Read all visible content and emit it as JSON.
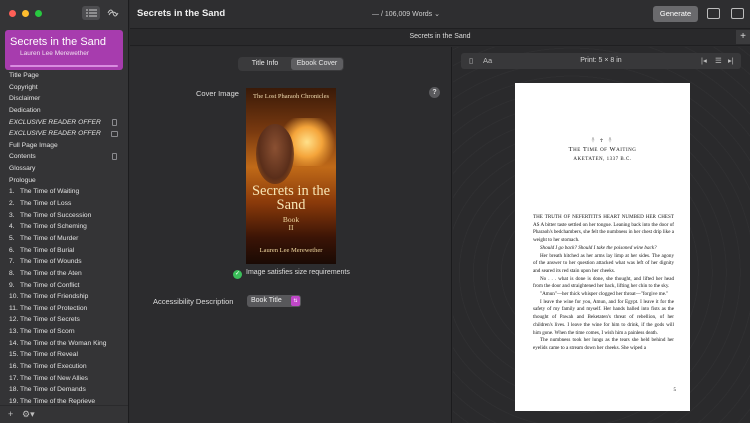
{
  "window": {
    "traffic_colors": [
      "#ff5f57",
      "#febc2e",
      "#28c840"
    ]
  },
  "sidebar": {
    "book_title": "Secrets in the Sand",
    "author": "Lauren Lee Merewether",
    "items": [
      {
        "label": "Title Page"
      },
      {
        "label": "Copyright"
      },
      {
        "label": "Disclaimer"
      },
      {
        "label": "Dedication"
      },
      {
        "label": "EXCLUSIVE READER OFFER",
        "italic": true,
        "icon": "phone-icon"
      },
      {
        "label": "EXCLUSIVE READER OFFER",
        "italic": true,
        "icon": "book-icon"
      },
      {
        "label": "Full Page Image"
      },
      {
        "label": "Contents",
        "icon": "phone-icon"
      },
      {
        "label": "Glossary"
      },
      {
        "label": "Prologue"
      },
      {
        "num": "1.",
        "label": "The Time of Waiting"
      },
      {
        "num": "2.",
        "label": "The Time of Loss"
      },
      {
        "num": "3.",
        "label": "The Time of Succession"
      },
      {
        "num": "4.",
        "label": "The Time of Scheming"
      },
      {
        "num": "5.",
        "label": "The Time of Murder"
      },
      {
        "num": "6.",
        "label": "The Time of Burial"
      },
      {
        "num": "7.",
        "label": "The Time of Wounds"
      },
      {
        "num": "8.",
        "label": "The Time of the Aten"
      },
      {
        "num": "9.",
        "label": "The Time of Conflict"
      },
      {
        "num": "10.",
        "label": "The Time of Friendship"
      },
      {
        "num": "11.",
        "label": "The Time of Protection"
      },
      {
        "num": "12.",
        "label": "The Time of Secrets"
      },
      {
        "num": "13.",
        "label": "The Time of Scorn"
      },
      {
        "num": "14.",
        "label": "The Time of the Woman King"
      },
      {
        "num": "15.",
        "label": "The Time of Reveal"
      },
      {
        "num": "16.",
        "label": "The Time of Execution"
      },
      {
        "num": "17.",
        "label": "The Time of New Allies"
      },
      {
        "num": "18.",
        "label": "The Time of Demands"
      },
      {
        "num": "19.",
        "label": "The Time of the Reprieve"
      }
    ]
  },
  "titlebar": {
    "title": "Secrets in the Sand",
    "word_count": "— / 106,009 Words",
    "generate": "Generate"
  },
  "subbar": {
    "chapter": "Secrets in the Sand"
  },
  "editor": {
    "tabs": [
      "Title Info",
      "Ebook Cover"
    ],
    "selected_tab": 1,
    "cover_label": "Cover Image",
    "cover": {
      "series": "The Lost Pharaoh Chronicles",
      "title": "Secrets in the Sand",
      "book": "Book",
      "book_num": "II",
      "author": "Lauren Lee Merewether"
    },
    "size_ok": "Image satisfies size requirements",
    "accessibility_label": "Accessibility Description",
    "accessibility_value": "Book Title"
  },
  "preview": {
    "print_size": "Print: 5 × 8 in",
    "page": {
      "ornament": "𓋹 ☥ 𓋹",
      "chapter_title": "The Time of Waiting",
      "place": "AKETATEN, 1337 B.C.",
      "paragraphs": [
        {
          "text": "THE TRUTH OF NEFERTITI'S HEART NUMBED HER CHEST AS A bitter taste settled on her tongue. Leaning back into the door of Pharaoh's bedchambers, she felt the numbness in her chest drip like a weight to her stomach.",
          "first": true
        },
        {
          "text": "Should I go back? Should I take the poisoned wine back?",
          "italic": true
        },
        {
          "text": "Her breath hitched as her arms lay limp at her sides. The agony of the answer to her question attacked what was left of her dignity and seared its red stain upon her cheeks."
        },
        {
          "text": "No . . . what is done is done, she thought, and lifted her head from the door and straightened her back, lifting her chin to the sky."
        },
        {
          "text": "\"Amun\"—her thick whisper clogged her throat—\"forgive me.\""
        },
        {
          "text": "I leave the wine for you, Amun, and for Egypt. I leave it for the safety of my family and myself. Her hands balled into fists as the thought of Pawah and Beketaten's threat of rebellion, of her children's lives. I leave the wine for him to drink, if the gods will him gone. When the time comes, I wish him a painless death."
        },
        {
          "text": "The numbness took her lungs as the tears she held behind her eyelids came to a stream down her cheeks. She wiped a"
        }
      ],
      "page_number": "5"
    }
  }
}
